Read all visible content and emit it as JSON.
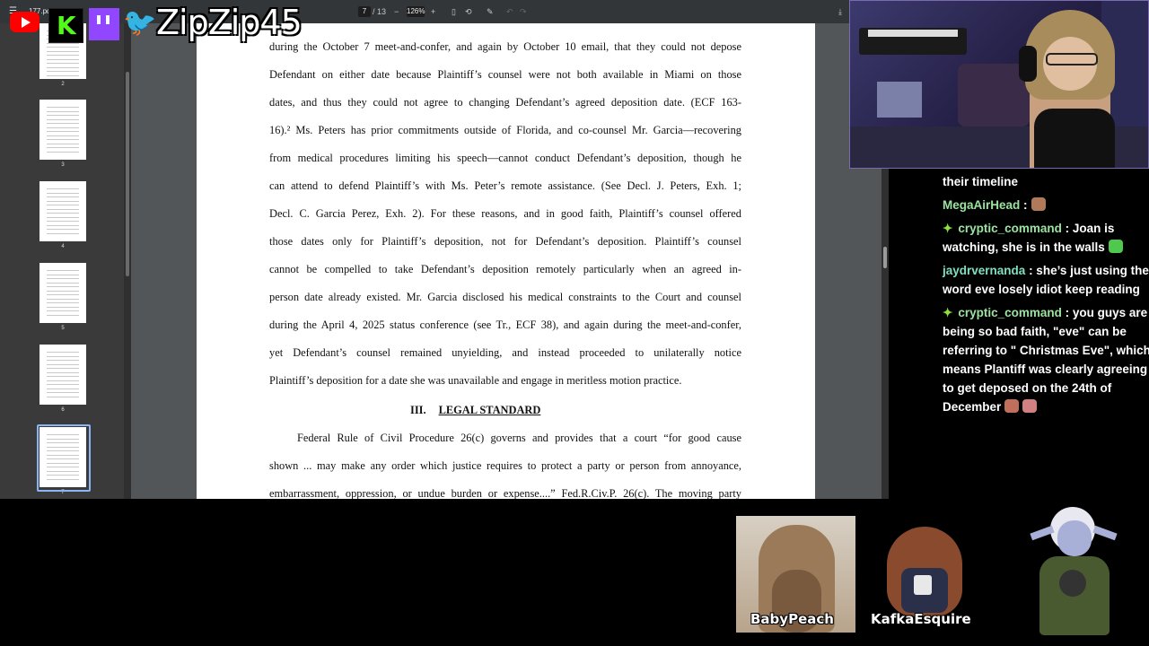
{
  "pdf_viewer": {
    "filename": "177.pdf",
    "page_current": "7",
    "page_total": "/ 13",
    "zoom": "126%",
    "thumbnails": [
      {
        "label": "2"
      },
      {
        "label": "3"
      },
      {
        "label": "4"
      },
      {
        "label": "5"
      },
      {
        "label": "6"
      },
      {
        "label": "7"
      }
    ],
    "selected_thumbnail": "7"
  },
  "document": {
    "lines": [
      "during the October 7 meet-and-confer, and again by October 10 email, that they could not depose",
      "Defendant on either date because Plaintiff’s counsel were not both available in Miami on those",
      "dates, and thus they could not agree to changing Defendant’s agreed deposition date. (ECF 163-",
      "16).² Ms. Peters has prior commitments outside of Florida, and co-counsel Mr. Garcia—recovering",
      "from medical procedures limiting his speech—cannot conduct Defendant’s deposition, though he",
      "can attend to defend Plaintiff’s with Ms. Peter’s remote assistance. (See Decl. J. Peters, Exh. 1;",
      "Decl. C. Garcia Perez, Exh. 2). For these reasons, and in good faith, Plaintiff’s counsel offered",
      "those dates only for Plaintiff’s deposition, not for Defendant’s deposition. Plaintiff’s counsel",
      "cannot be compelled to take Defendant’s deposition remotely particularly when an agreed in-",
      "person date already existed. Mr. Garcia disclosed his medical constraints to the Court and counsel",
      "during the April 4, 2025 status conference (see Tr., ECF 38), and again during the meet-and-confer,",
      "yet Defendant’s counsel remained unyielding, and instead proceeded to unilaterally notice"
    ],
    "last_line": "Plaintiff’s deposition for a date she was unavailable and engage in meritless motion practice.",
    "heading_number": "III.",
    "heading_title": "LEGAL STANDARD",
    "para2_lines": [
      "Federal Rule of Civil Procedure 26(c) governs and provides that a court “for good cause",
      "shown ... may make any order which justice requires to protect a party or person from annoyance,",
      "embarrassment, oppression, or undue burden or expense....” Fed.R.Civ.P. 26(c). The moving party"
    ]
  },
  "stream": {
    "channel_name": "ZipZip45",
    "kick_letter": "K"
  },
  "chat": {
    "messages": [
      {
        "user": "",
        "text": "their timeline",
        "user_color": "#ffffff",
        "mod": false
      },
      {
        "user": "MegaAirHead",
        "text": ":",
        "user_color": "#9be3a0",
        "mod": false
      },
      {
        "user": "cryptic_command",
        "text": ": Joan is watching, she is in the walls",
        "user_color": "#9be3a0",
        "mod": true
      },
      {
        "user": "jaydrvernanda",
        "text": ": she’s just using the word eve losely idiot keep reading",
        "user_color": "#7fe0c0",
        "mod": false
      },
      {
        "user": "cryptic_command",
        "text": ": you guys are being so bad faith, \"eve\" can be referring to \" Christmas Eve\", which means Plantiff was clearly agreeing to get deposed on the 24th of December",
        "user_color": "#9be3a0",
        "mod": true
      }
    ]
  },
  "guests": [
    {
      "name": "BabyPeach"
    },
    {
      "name": "KafkaEsquire"
    }
  ]
}
